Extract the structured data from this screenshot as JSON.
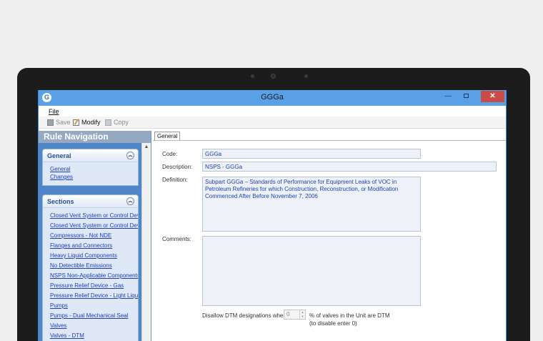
{
  "window": {
    "app_icon": "G",
    "title": "GGGa",
    "close_symbol": "✕",
    "minimize_symbol": "—"
  },
  "menu": {
    "file_label": "File"
  },
  "toolbar": {
    "save_label": "Save",
    "modify_label": "Modify",
    "copy_label": "Copy"
  },
  "nav": {
    "header": "Rule Navigation",
    "general_panel": {
      "title": "General",
      "items": [
        "General",
        "Changes"
      ]
    },
    "sections_panel": {
      "title": "Sections",
      "items": [
        "Closed Vent System or Control Device",
        "Closed Vent System or Control Device",
        "Compressors - Not NDE",
        "Flanges and Connectors",
        "Heavy Liquid Components",
        "No Detectible Emissions",
        "NSPS Non-Applicable Components",
        "Pressure Relief Device - Gas",
        "Pressure Relief Device - Light Liquid",
        "Pumps",
        "Pumps - Dual Mechanical Seal",
        "Valves",
        "Valves - DTM"
      ]
    }
  },
  "form": {
    "tab_label": "General",
    "code_label": "Code:",
    "code_value": "GGGa",
    "description_label": "Description:",
    "description_value": "NSPS - GGGa",
    "definition_label": "Definition:",
    "definition_value": "Subpart GGGa – Standards of Performance for Equipment Leaks of VOC in Petroleum Refineries for which Construction, Reconstruction, or Modification Commenced After Before November 7, 2006",
    "comments_label": "Comments:",
    "comments_value": "",
    "dtm_label": "Disallow DTM designations when",
    "dtm_value": "0",
    "dtm_suffix": "% of valves in the Unit are DTM",
    "dtm_hint": "(to disable enter 0)"
  },
  "colors": {
    "titlebar": "#5aa0e6",
    "nav_background": "#4f86c8",
    "link": "#1f3fb8",
    "close_button": "#c94c46"
  }
}
